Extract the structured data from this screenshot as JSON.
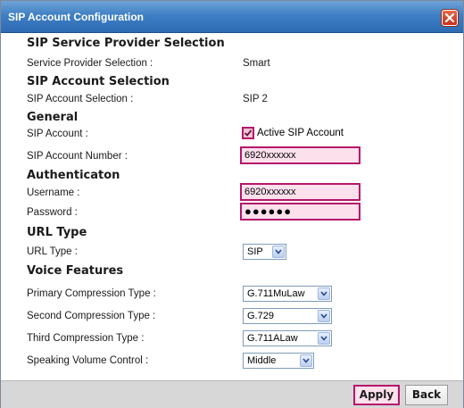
{
  "window": {
    "title": "SIP Account Configuration"
  },
  "sections": {
    "provider": "SIP Service Provider Selection",
    "account": "SIP Account Selection",
    "general": "General",
    "auth": "Authenticaton",
    "url": "URL Type",
    "voice": "Voice Features"
  },
  "fields": {
    "provider_label": "Service Provider Selection :",
    "provider_value": "Smart",
    "account_sel_label": "SIP Account Selection :",
    "account_sel_value": "SIP 2",
    "sip_account_label": "SIP Account :",
    "active_label": "Active SIP Account",
    "active_checked": true,
    "number_label": "SIP Account Number :",
    "number_value": "6920xxxxxx",
    "username_label": "Username :",
    "username_value": "6920xxxxxx",
    "password_label": "Password :",
    "password_value": "●●●●●●",
    "url_type_label": "URL Type :",
    "url_type_value": "SIP",
    "primary_label": "Primary Compression Type :",
    "primary_value": "G.711MuLaw",
    "second_label": "Second Compression Type :",
    "second_value": "G.729",
    "third_label": "Third Compression Type :",
    "third_value": "G.711ALaw",
    "volume_label": "Speaking Volume Control :",
    "volume_value": "Middle"
  },
  "footer": {
    "apply_label": "Apply",
    "back_label": "Back"
  },
  "icons": {
    "close": "close-icon",
    "check": "check-icon",
    "dropdown": "chevron-down-icon"
  },
  "colors": {
    "accent": "#b5166b",
    "accent_fill": "#fce0ec",
    "titlebar": "#3f7fc4",
    "footer": "#d7d7d7"
  }
}
